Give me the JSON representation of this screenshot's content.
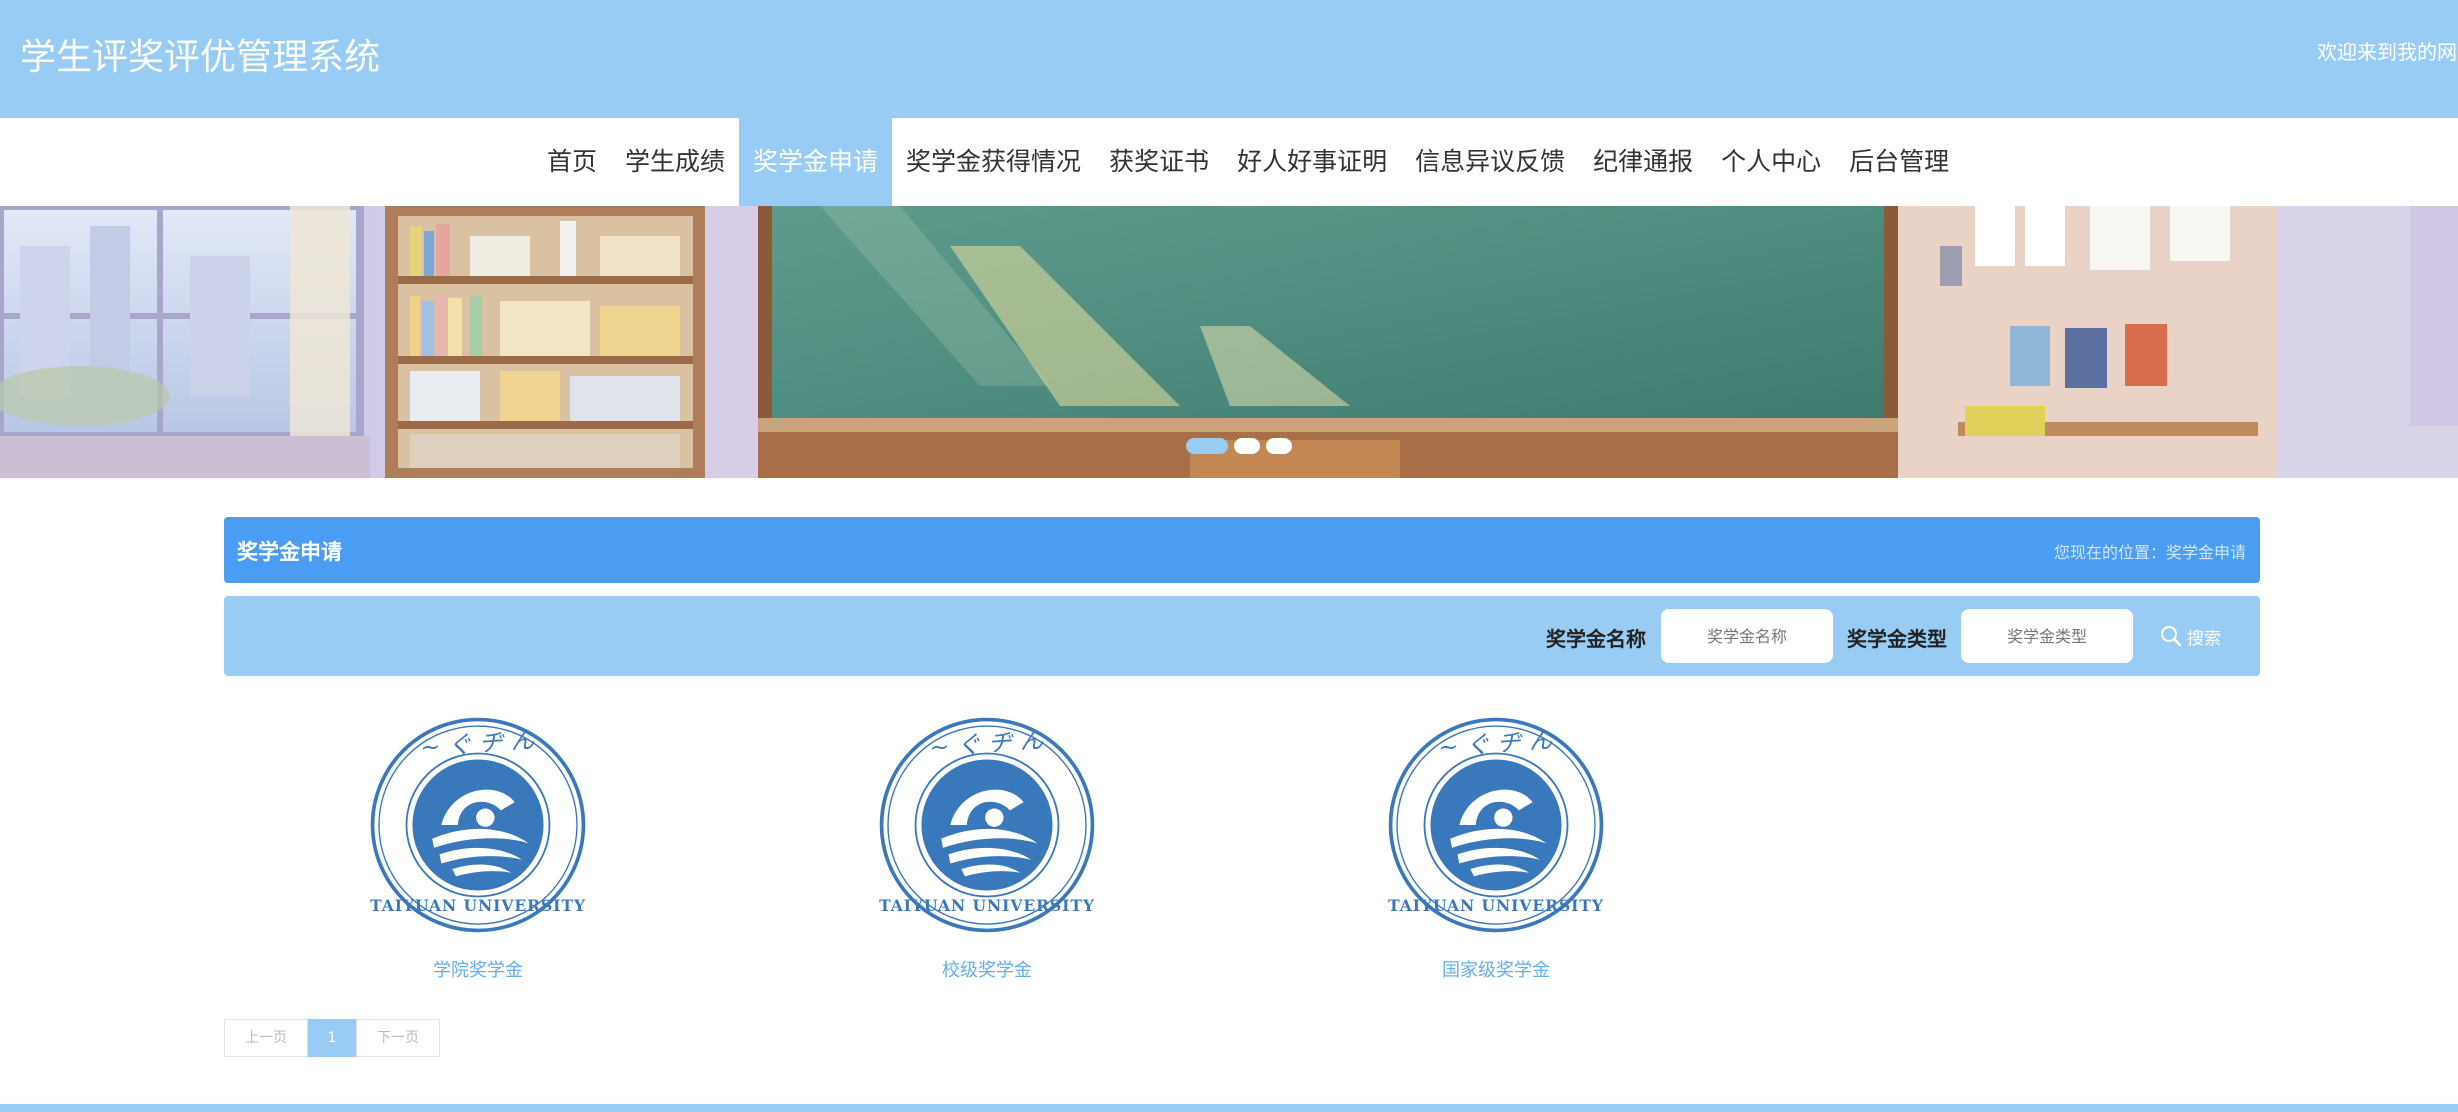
{
  "header": {
    "title": "学生评奖评优管理系统",
    "welcome": "欢迎来到我的网"
  },
  "nav": {
    "items": [
      "首页",
      "学生成绩",
      "奖学金申请",
      "奖学金获得情况",
      "获奖证书",
      "好人好事证明",
      "信息异议反馈",
      "纪律通报",
      "个人中心",
      "后台管理"
    ],
    "active": "奖学金申请"
  },
  "banner": {
    "slides": 3,
    "active_slide": 1
  },
  "section": {
    "title": "奖学金申请",
    "breadcrumb_prefix": "您现在的位置：",
    "breadcrumb_current": "奖学金申请"
  },
  "search": {
    "name_label": "奖学金名称",
    "name_placeholder": "奖学金名称",
    "type_label": "奖学金类型",
    "type_placeholder": "奖学金类型",
    "button_label": "搜索"
  },
  "cards": [
    {
      "caption": "学院奖学金"
    },
    {
      "caption": "校级奖学金"
    },
    {
      "caption": "国家级奖学金"
    }
  ],
  "logo": {
    "name_text": "TAIYUAN UNIVERSITY",
    "script_text": "太原学院"
  },
  "pagination": {
    "prev": "上一页",
    "current": "1",
    "next": "下一页"
  },
  "colors": {
    "header_bg": "#98ccf5",
    "accent_blue": "#4a9df2",
    "caption_blue": "#64aef0",
    "logo_blue": "#3a78bc"
  }
}
